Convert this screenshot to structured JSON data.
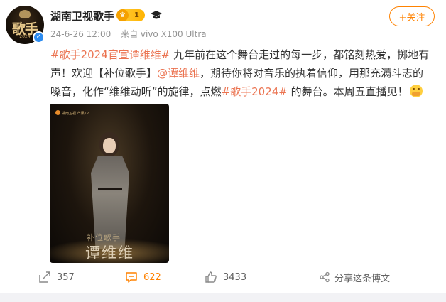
{
  "post": {
    "author": "湖南卫视歌手",
    "vip_level": "1",
    "timestamp": "24-6-26 12:00",
    "source": "来自 vivo X100 Ultra",
    "follow_label": "+关注",
    "avatar": {
      "text": "歌手",
      "year": "2024"
    },
    "content": {
      "tag1": "#歌手2024官宣谭维维#",
      "seg1": " 九年前在这个舞台走过的每一步，都铭刻热爱，掷地有声！欢迎【补位歌手】",
      "mention": "@谭维维",
      "seg2": "，期待你将对音乐的执着信仰，用那充满斗志的嗓音，化作“维维动听”的旋律，点燃",
      "tag2": "#歌手2024#",
      "seg3": " 的舞台。本周五直播见！"
    },
    "poster": {
      "subtitle": "补位歌手",
      "name": "谭维维",
      "logos": "湖南卫视  芒果TV",
      "small_text": "SINGER  2024"
    }
  },
  "actions": {
    "repost_count": "357",
    "comment_count": "622",
    "like_count": "3433",
    "share_label": "分享这条博文"
  },
  "colors": {
    "accent": "#ff8200",
    "topic": "#eb7350",
    "meta": "#939393",
    "verified": "#2d8cf0"
  },
  "icons": [
    "verified-icon",
    "crown-icon",
    "graduation-cap-icon",
    "repost-icon",
    "comment-icon",
    "like-icon",
    "share-icon",
    "emoji-icon"
  ]
}
